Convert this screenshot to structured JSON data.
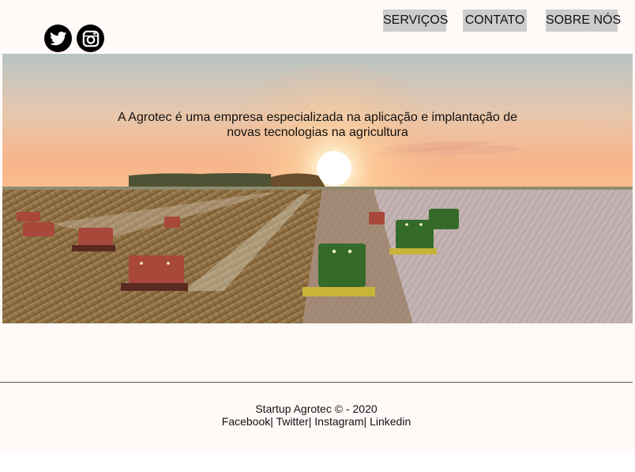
{
  "header": {
    "social": [
      {
        "name": "twitter-icon"
      },
      {
        "name": "instagram-icon"
      }
    ],
    "nav": {
      "servicos": "SERVIÇOS",
      "contato": "CONTATO",
      "sobre": "SOBRE NÓS"
    }
  },
  "hero": {
    "text": "A Agrotec é uma empresa especializada na aplicação e implantação de novas tecnologias na agricultura"
  },
  "footer": {
    "copyright": "Startup Agrotec © - 2020",
    "links": {
      "facebook": "Facebook",
      "sep1": "| ",
      "twitter": "Twitter",
      "sep2": "| ",
      "instagram": "Instagram",
      "sep3": "| ",
      "linkedin": "Linkedin"
    }
  },
  "colors": {
    "nav_button_bg": "#cccccc",
    "page_bg": "#fffaf8",
    "icon_bg": "#000000"
  }
}
